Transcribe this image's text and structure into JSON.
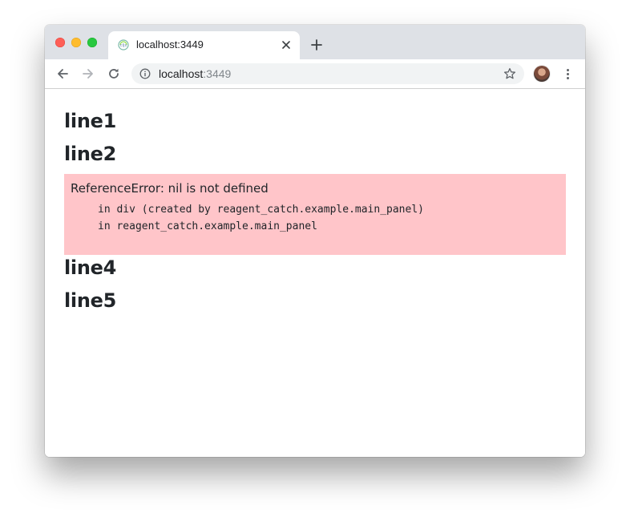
{
  "tab": {
    "title": "localhost:3449"
  },
  "omnibox": {
    "host": "localhost",
    "port": ":3449"
  },
  "icons": {
    "favicon": "cljs-logo-icon",
    "tab_close": "close-icon",
    "new_tab": "plus-icon",
    "back": "arrow-left-icon",
    "forward": "arrow-right-icon",
    "reload": "reload-icon",
    "info": "info-icon",
    "bookmark": "star-icon",
    "menu": "more-vert-icon"
  },
  "colors": {
    "error_background": "#ffc5c9",
    "tab_strip": "#dee1e6",
    "text": "#212529"
  },
  "page": {
    "lines": [
      "line1",
      "line2",
      "line4",
      "line5"
    ],
    "error": {
      "message": "ReferenceError: nil is not defined",
      "stack": [
        "in div (created by reagent_catch.example.main_panel)",
        "in reagent_catch.example.main_panel"
      ]
    }
  }
}
